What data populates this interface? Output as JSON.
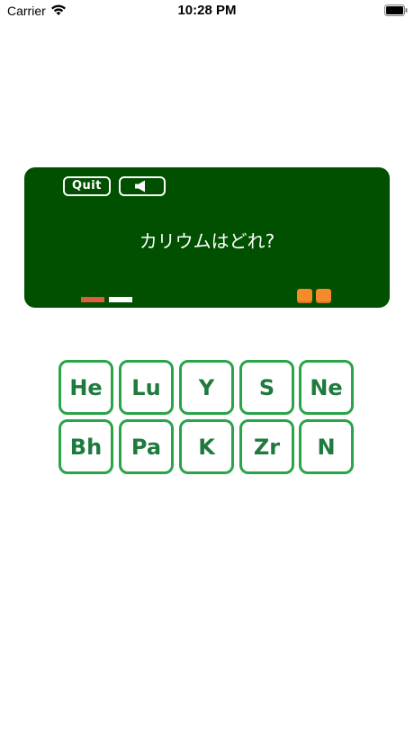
{
  "status_bar": {
    "carrier": "Carrier",
    "time": "10:28 PM",
    "wifi_icon": "wifi-icon",
    "battery_icon": "battery-icon"
  },
  "chalkboard": {
    "background_color": "#005000",
    "quit_label": "Quit",
    "sound_icon": "speaker-icon",
    "question": "カリウムはどれ?",
    "progress": {
      "colors": [
        "#e25b3d",
        "#ffffff"
      ]
    },
    "lives": {
      "count": 2,
      "color": "#f68a2a"
    }
  },
  "elements": {
    "border_color": "#2ba348",
    "text_color": "#1e7a3d",
    "rows": [
      [
        "He",
        "Lu",
        "Y",
        "S",
        "Ne"
      ],
      [
        "Bh",
        "Pa",
        "K",
        "Zr",
        "N"
      ]
    ]
  }
}
